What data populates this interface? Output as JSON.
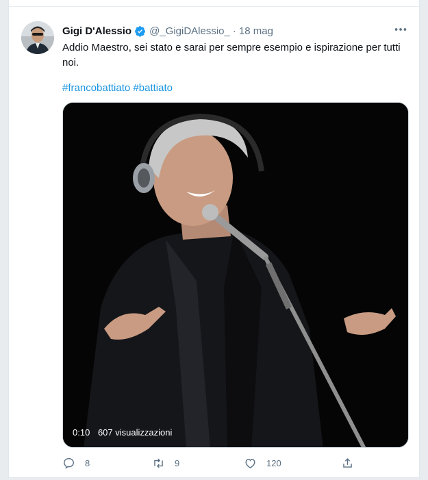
{
  "tweet": {
    "author_name": "Gigi D'Alessio",
    "handle": "@_GigiDAlessio_",
    "separator": "·",
    "date": "18 mag",
    "text": "Addio Maestro, sei stato e sarai per sempre esempio e ispirazione per tutti noi.",
    "hashtags": [
      "#francobattiato",
      "#battiato"
    ],
    "video": {
      "duration": "0:10",
      "views": "607 visualizzazioni"
    },
    "actions": {
      "replies": "8",
      "retweets": "9",
      "likes": "120"
    }
  },
  "colors": {
    "link": "#1b95e0",
    "muted": "#5b7083",
    "verified": "#1d9bf0"
  },
  "icons": [
    "verified-badge-icon",
    "more-options-icon",
    "reply-icon",
    "retweet-icon",
    "like-icon",
    "share-icon"
  ]
}
